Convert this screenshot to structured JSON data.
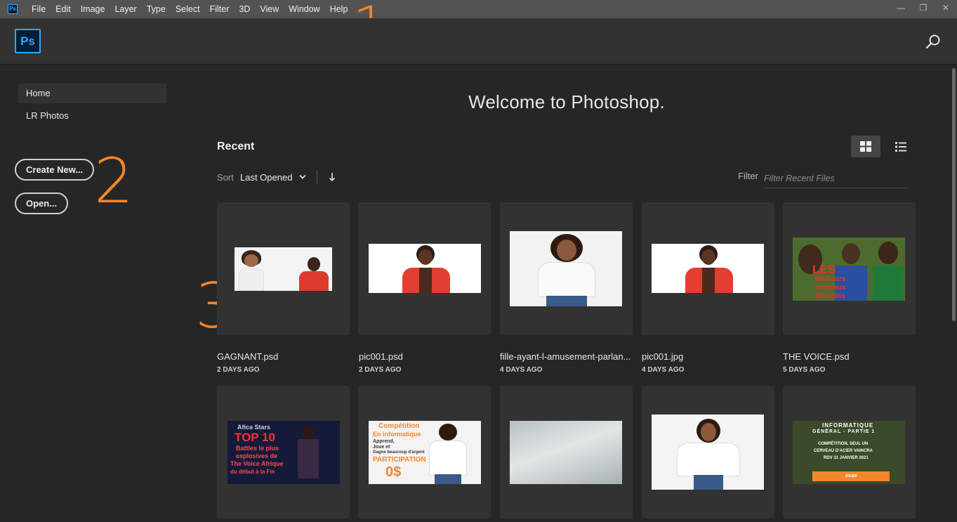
{
  "app": {
    "icon_label": "Ps",
    "logo_label": "Ps"
  },
  "menu": [
    "File",
    "Edit",
    "Image",
    "Layer",
    "Type",
    "Select",
    "Filter",
    "3D",
    "View",
    "Window",
    "Help"
  ],
  "window_controls": {
    "minimize": "—",
    "restore": "❐",
    "close": "✕"
  },
  "annotations": {
    "one": "1",
    "two": "2",
    "three": "3"
  },
  "sidebar": {
    "items": [
      {
        "label": "Home",
        "active": true
      },
      {
        "label": "LR Photos",
        "active": false
      }
    ],
    "create_new": "Create New...",
    "open": "Open..."
  },
  "main": {
    "welcome": "Welcome to Photoshop.",
    "recent_title": "Recent",
    "sort_label": "Sort",
    "sort_value": "Last Opened",
    "filter_label": "Filter",
    "filter_placeholder": "Filter Recent Files",
    "view_mode": "grid"
  },
  "files": [
    {
      "name": "GAGNANT.psd",
      "date": "2 DAYS AGO"
    },
    {
      "name": "pic001.psd",
      "date": "2 DAYS AGO"
    },
    {
      "name": "fille-ayant-l-amusement-parlan...",
      "date": "4 DAYS AGO"
    },
    {
      "name": "pic001.jpg",
      "date": "4 DAYS AGO"
    },
    {
      "name": "THE VOICE.psd",
      "date": "5 DAYS AGO"
    },
    {
      "name": "",
      "date": ""
    },
    {
      "name": "",
      "date": ""
    },
    {
      "name": "",
      "date": ""
    },
    {
      "name": "",
      "date": ""
    },
    {
      "name": "",
      "date": ""
    }
  ],
  "thumb_text": {
    "voice_lines": [
      "LES",
      "Meilleurs",
      "cerveaux",
      "Africains"
    ],
    "top10_lines": [
      "Afica Stars",
      "TOP 10",
      "Battles le plus",
      "explosives de",
      "The Voice Afrique",
      "du début à la Fin"
    ],
    "competition_lines": [
      "Compétition",
      "En informatique",
      "Apprend,",
      "Joue et",
      "Gagne beaucoup d'argent",
      "PARTICIPATION",
      "0$"
    ],
    "informatique_lines": [
      "INFORMATIQUE",
      "GÉNÉRAL - PARTIE 1",
      "COMPÉTITION, SEUL UN",
      "CERVEAU D'ACIER VAINCRA",
      "RDV 31 JANVIER 2021",
      "JOUER"
    ]
  },
  "colors": {
    "accent_orange": "#f5862c",
    "ps_blue": "#31a8ff",
    "ps_dark": "#001e36"
  }
}
